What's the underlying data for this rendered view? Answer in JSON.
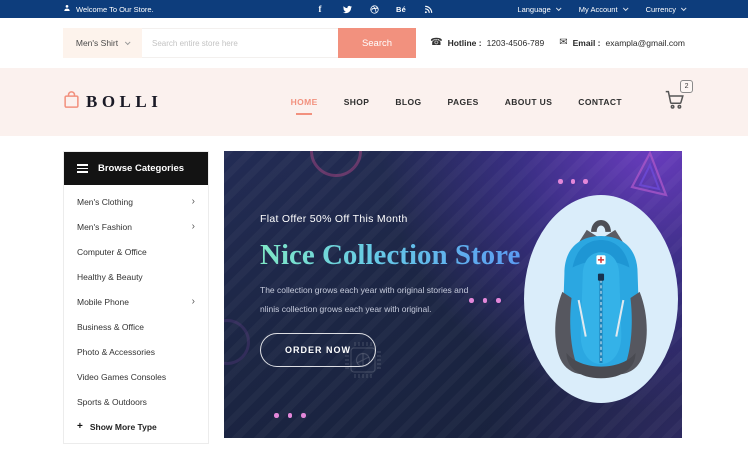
{
  "topbar": {
    "welcome": "Welcome To Our Store.",
    "social": [
      {
        "name": "facebook"
      },
      {
        "name": "twitter"
      },
      {
        "name": "dribbble"
      },
      {
        "name": "behance"
      },
      {
        "name": "rss"
      }
    ],
    "menus": [
      {
        "label": "Language"
      },
      {
        "label": "My Account"
      },
      {
        "label": "Currency"
      }
    ]
  },
  "search": {
    "category": "Men's Shirt",
    "placeholder": "Search entire store here",
    "button_label": "Search",
    "hotline_label": "Hotline :",
    "hotline_value": "1203-4506-789",
    "email_label": "Email :",
    "email_value": "exampla@gmail.com"
  },
  "header": {
    "logo_text": "BOLLI",
    "nav": [
      {
        "label": "HOME",
        "active": true
      },
      {
        "label": "SHOP",
        "active": false
      },
      {
        "label": "BLOG",
        "active": false
      },
      {
        "label": "PAGES",
        "active": false
      },
      {
        "label": "ABOUT US",
        "active": false
      },
      {
        "label": "CONTACT",
        "active": false
      }
    ],
    "cart_count": "2"
  },
  "sidebar": {
    "title": "Browse Categories",
    "items": [
      {
        "label": "Men's Clothing",
        "has_children": true
      },
      {
        "label": "Men's Fashion",
        "has_children": true
      },
      {
        "label": "Computer & Office",
        "has_children": false
      },
      {
        "label": "Healthy & Beauty",
        "has_children": false
      },
      {
        "label": "Mobile Phone",
        "has_children": true
      },
      {
        "label": "Business & Office",
        "has_children": false
      },
      {
        "label": "Photo & Accessories",
        "has_children": false
      },
      {
        "label": "Video Games Consoles",
        "has_children": false
      },
      {
        "label": "Sports & Outdoors",
        "has_children": false
      }
    ],
    "show_more_label": "Show More Type"
  },
  "hero": {
    "offer_text": "Flat Offer 50% Off This Month",
    "title": "Nice Collection Store",
    "description_line1": "The collection grows each year with original stories and",
    "description_line2": "nlinis collection grows each year with original.",
    "order_button": "ORDER NOW"
  },
  "colors": {
    "accent_salmon": "#f2917e",
    "topbar_blue": "#0d3d7c",
    "header_pink": "#fbf1ee",
    "hero_navy": "#1c2644",
    "hero_purple": "#5a3cae",
    "title_gradient_start": "#7fe7c6",
    "title_gradient_end": "#5b9bf2",
    "blob_blue": "#daedfa",
    "dot_pink": "#e387d9"
  }
}
